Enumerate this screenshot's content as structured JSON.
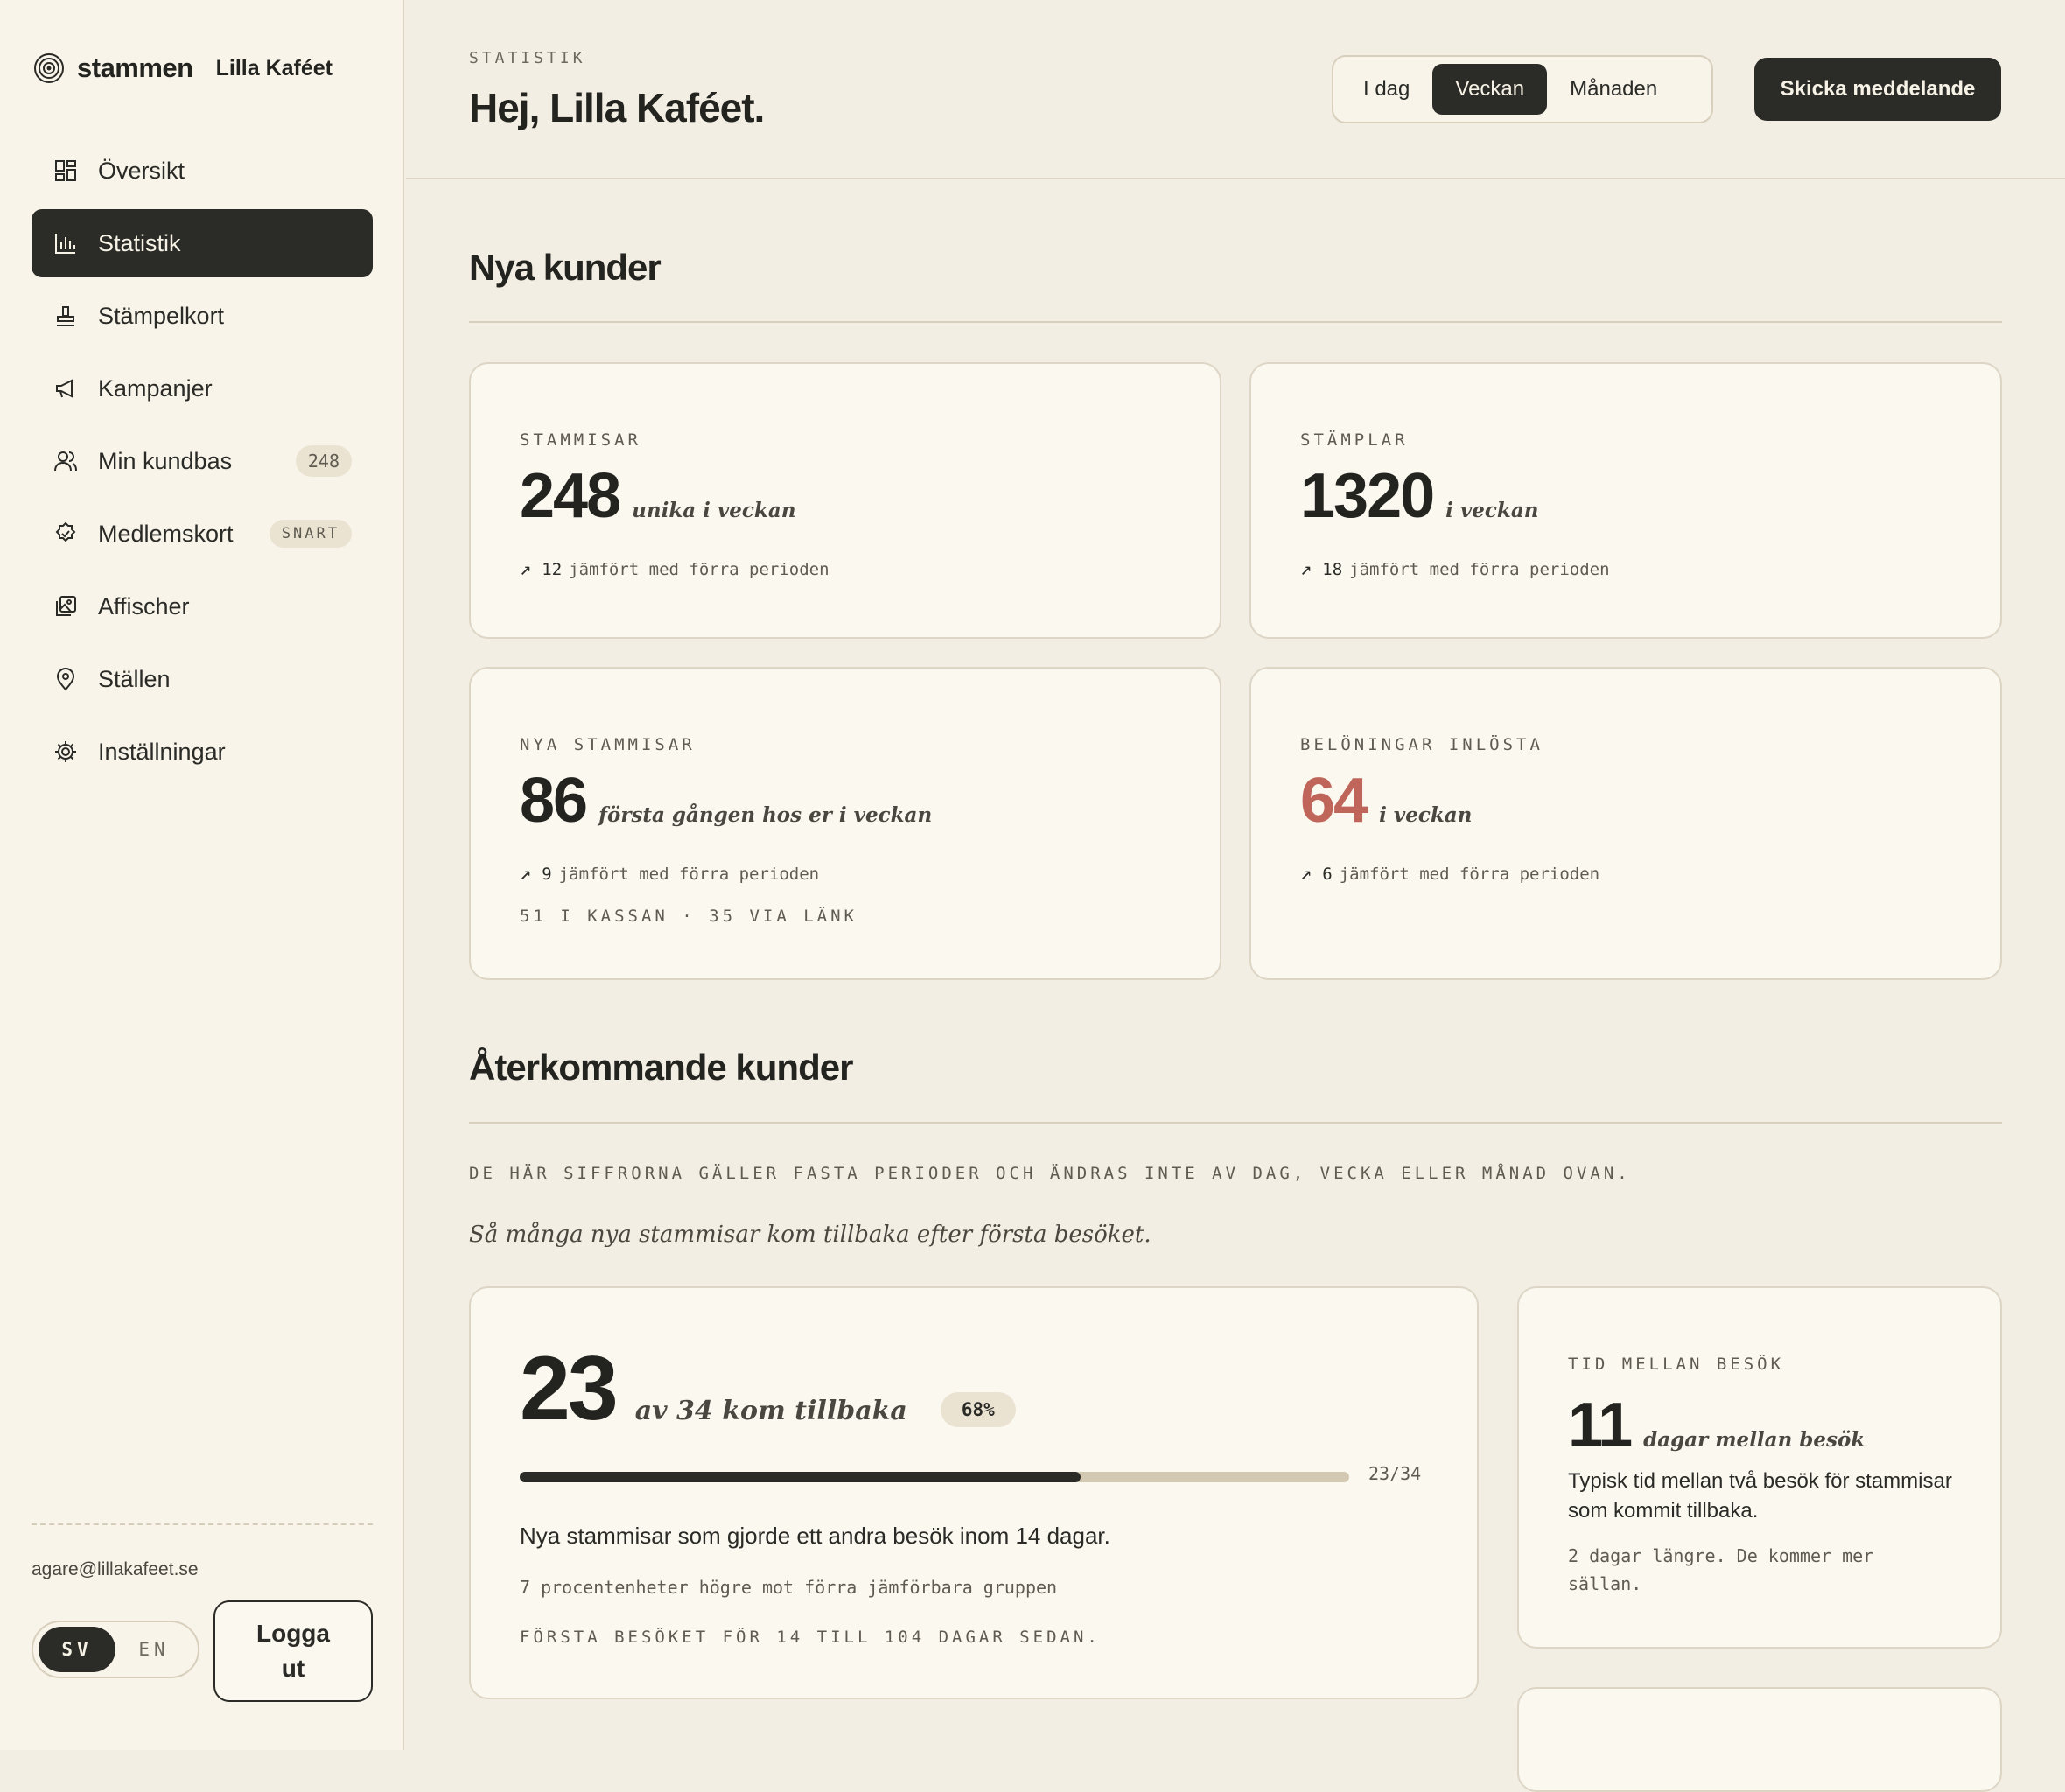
{
  "brand": {
    "name": "stammen",
    "place": "Lilla Kaféet"
  },
  "sidebar": {
    "items": [
      {
        "label": "Översikt"
      },
      {
        "label": "Statistik"
      },
      {
        "label": "Stämpelkort"
      },
      {
        "label": "Kampanjer"
      },
      {
        "label": "Min kundbas",
        "badge": "248"
      },
      {
        "label": "Medlemskort",
        "badge": "SNART"
      },
      {
        "label": "Affischer"
      },
      {
        "label": "Ställen"
      },
      {
        "label": "Inställningar"
      }
    ],
    "active_index": 1,
    "email": "agare@lillakafeet.se",
    "lang": {
      "sv": "SV",
      "en": "EN",
      "selected": "SV"
    },
    "logout": "Logga ut"
  },
  "header": {
    "eyebrow": "STATISTIK",
    "greeting": "Hej, Lilla Kaféet.",
    "periods": [
      "I dag",
      "Veckan",
      "Månaden"
    ],
    "selected_period": "Veckan",
    "send_button": "Skicka meddelande"
  },
  "new_customers": {
    "title": "Nya kunder",
    "cards": [
      {
        "label": "STAMMISAR",
        "value": "248",
        "unit": "unika i veckan",
        "trend_num": "12",
        "trend_text": "jämfört med förra perioden"
      },
      {
        "label": "STÄMPLAR",
        "value": "1320",
        "unit": "i veckan",
        "trend_num": "18",
        "trend_text": "jämfört med förra perioden"
      },
      {
        "label": "NYA STAMMISAR",
        "value": "86",
        "unit": "första gången hos er i veckan",
        "trend_num": "9",
        "trend_text": "jämfört med förra perioden",
        "sub": "51 I KASSAN · 35 VIA LÄNK"
      },
      {
        "label": "BELÖNINGAR INLÖSTA",
        "value": "64",
        "unit": "i veckan",
        "trend_num": "6",
        "trend_text": "jämfört med förra perioden",
        "value_color": "#c0655a"
      }
    ]
  },
  "returning": {
    "title": "Återkommande kunder",
    "note": "DE HÄR SIFFRORNA GÄLLER FASTA PERIODER OCH ÄNDRAS INTE AV DAG, VECKA ELLER MÅNAD OVAN.",
    "intro": "Så många nya stammisar kom tillbaka efter första besöket.",
    "main_card": {
      "value": "23",
      "unit": "av 34 kom tillbaka",
      "percent_badge": "68%",
      "progress_fraction": 0.676,
      "progress_label": "23/34",
      "description": "Nya stammisar som gjorde ett andra besök inom 14 dagar.",
      "comparison": "7 procentenheter högre mot förra jämförbara gruppen",
      "footnote": "FÖRSTA BESÖKET FÖR 14 TILL 104 DAGAR SEDAN."
    },
    "side_card": {
      "label": "TID MELLAN BESÖK",
      "value": "11",
      "unit": "dagar mellan besök",
      "description": "Typisk tid mellan två besök för stammisar som kommit tillbaka.",
      "comparison": "2 dagar längre. De kommer mer sällan."
    }
  },
  "colors": {
    "accent_dark": "#2b2b27",
    "background": "#f3eee3",
    "card": "#fbf8f0",
    "reward": "#c0655a"
  }
}
